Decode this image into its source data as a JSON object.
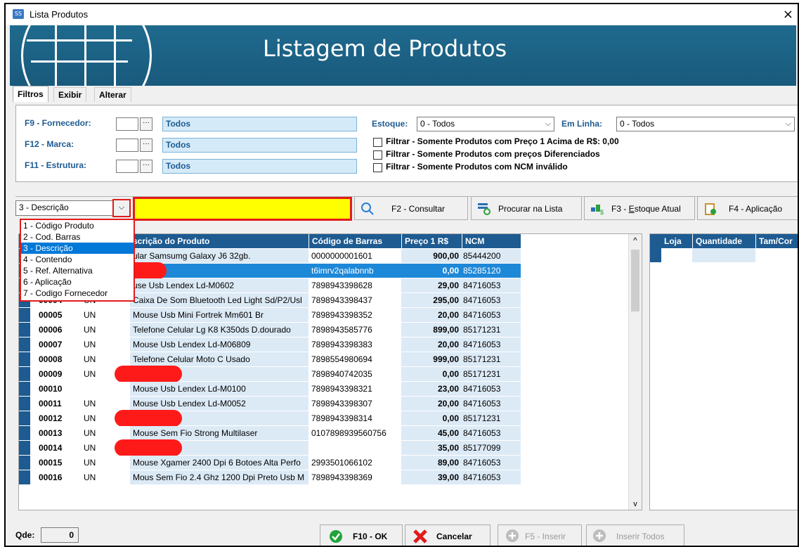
{
  "window": {
    "title": "Lista Produtos",
    "close_glyph": "×"
  },
  "banner": {
    "title": "Listagem de Produtos"
  },
  "tabs": [
    "Filtros",
    "Exibir",
    "Alterar"
  ],
  "filters": {
    "fornecedor": {
      "label": "F9 - Fornecedor:",
      "value": "Todos"
    },
    "marca": {
      "label": "F12 - Marca:",
      "value": "Todos"
    },
    "estrutura": {
      "label": "F11 - Estrutura:",
      "value": "Todos"
    },
    "dots": "···",
    "estoque": {
      "label": "Estoque:",
      "value": "0 - Todos"
    },
    "em_linha": {
      "label": "Em Linha:",
      "value": "0 - Todos"
    },
    "checks": [
      "Filtrar - Somente Produtos com Preço 1 Acima de R$: 0,00",
      "Filtrar - Somente Produtos com preços Diferenciados",
      "Filtrar - Somente Produtos com NCM inválido"
    ]
  },
  "search": {
    "field_select": "3 - Descrição",
    "options": [
      "1 - Código Produto",
      "2 - Cod. Barras",
      "3 - Descrição",
      "4 - Contendo",
      "5 - Ref. Alternativa",
      "6 - Aplicação",
      "7 - Codigo Fornecedor"
    ],
    "query": "",
    "highlight_color": "#ffff00"
  },
  "toolbar": {
    "consultar": "F2 - Consultar",
    "procurar": "Procurar na Lista",
    "estoque_pre": "F3 - ",
    "estoque_u": "E",
    "estoque_post": "stoque Atual",
    "aplicacao": "F4 - Aplicação"
  },
  "grid": {
    "columns": [
      "scrição do Produto",
      "Código de Barras",
      "Preço 1 R$",
      "NCM"
    ],
    "rows": [
      {
        "code": "",
        "un": "",
        "desc": "ular Samsumg Galaxy J6 32gb.",
        "barcode": "0000000001601",
        "price": "900,00",
        "ncm": "85444200"
      },
      {
        "code": "",
        "un": "",
        "desc": "",
        "barcode": "t6imrv2qalabnnb",
        "price": "0,00",
        "ncm": "85285120",
        "selected": true,
        "redacted": true
      },
      {
        "code": "",
        "un": "",
        "desc": "use Usb Lendex Ld-M0602",
        "barcode": "7898943398628",
        "price": "29,00",
        "ncm": "84716053"
      },
      {
        "code": "00004",
        "un": "UN",
        "desc": "Caixa De Som Bluetooth Led Light Sd/P2/Usl",
        "barcode": "7898943398437",
        "price": "295,00",
        "ncm": "84716053"
      },
      {
        "code": "00005",
        "un": "UN",
        "desc": "Mouse Usb Mini Fortrek Mm601 Br",
        "barcode": "7898943398352",
        "price": "20,00",
        "ncm": "84716053"
      },
      {
        "code": "00006",
        "un": "UN",
        "desc": "Telefone Celular Lg K8 K350ds D.dourado",
        "barcode": "7898943585776",
        "price": "899,00",
        "ncm": "85171231"
      },
      {
        "code": "00007",
        "un": "UN",
        "desc": "Mouse Usb Lendex Ld-M06809",
        "barcode": "7898943398383",
        "price": "20,00",
        "ncm": "84716053"
      },
      {
        "code": "00008",
        "un": "UN",
        "desc": "Telefone Celular Moto C Usado",
        "barcode": "7898554980694",
        "price": "999,00",
        "ncm": "85171231"
      },
      {
        "code": "00009",
        "un": "UN",
        "desc": "",
        "barcode": "7898940742035",
        "price": "0,00",
        "ncm": "85171231",
        "redacted": true
      },
      {
        "code": "00010",
        "un": "",
        "desc": "Mouse Usb Lendex Ld-M0100",
        "barcode": "7898943398321",
        "price": "23,00",
        "ncm": "84716053"
      },
      {
        "code": "00011",
        "un": "UN",
        "desc": "Mouse Usb Lendex Ld-M0052",
        "barcode": "7898943398307",
        "price": "20,00",
        "ncm": "84716053"
      },
      {
        "code": "00012",
        "un": "UN",
        "desc": "",
        "barcode": "7898943398314",
        "price": "0,00",
        "ncm": "85171231",
        "redacted": true
      },
      {
        "code": "00013",
        "un": "UN",
        "desc": "Mouse Sem Fio Strong Multilaser",
        "barcode": "0107898939560756",
        "price": "45,00",
        "ncm": "84716053"
      },
      {
        "code": "00014",
        "un": "UN",
        "desc": "",
        "barcode": "",
        "price": "35,00",
        "ncm": "85177099",
        "redacted": true
      },
      {
        "code": "00015",
        "un": "UN",
        "desc": "Mouse Xgamer 2400 Dpi 6 Botoes Alta Perfo",
        "barcode": "2993501066102",
        "price": "89,00",
        "ncm": "84716053"
      },
      {
        "code": "00016",
        "un": "UN",
        "desc": "Mous Sem Fio 2.4 Ghz 1200 Dpi Preto Usb M",
        "barcode": "7898943398369",
        "price": "39,00",
        "ncm": "84716053"
      }
    ]
  },
  "side_grid": {
    "columns": [
      "Loja",
      "Quantidade",
      "Tam/Cor"
    ]
  },
  "scroll": {
    "up": "^",
    "down": "v"
  },
  "bottom": {
    "qde_label": "Qde:",
    "qde_value": "0",
    "ok": "F10 - OK",
    "cancel": "Cancelar",
    "insert": "F5 - Inserir",
    "insert_all": "Inserir Todos"
  }
}
